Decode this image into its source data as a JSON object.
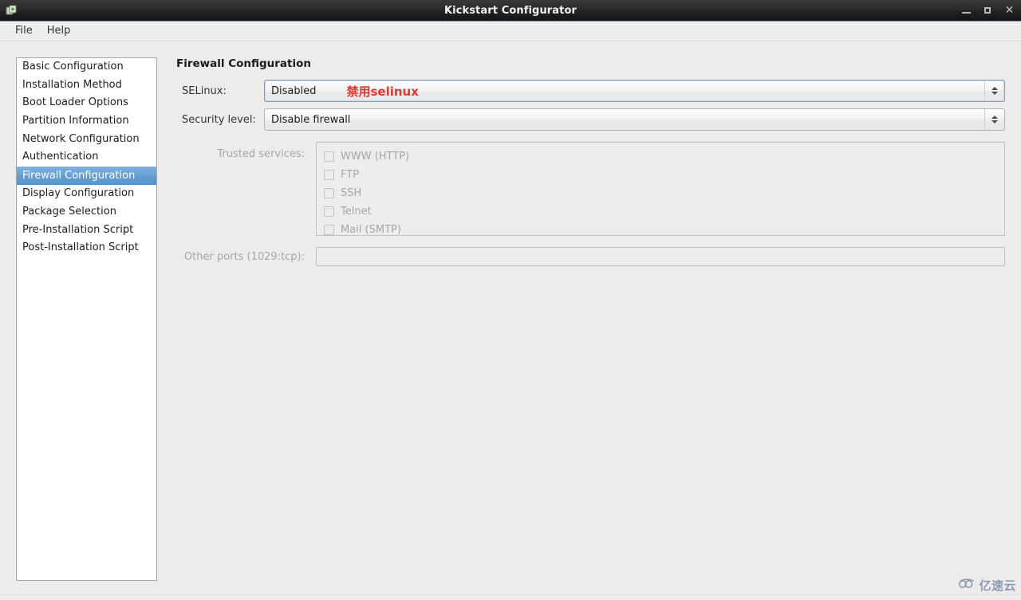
{
  "window": {
    "title": "Kickstart Configurator",
    "icon": "app-icon",
    "controls": {
      "minimize": "minimize-button",
      "maximize": "maximize-button",
      "close": "✕"
    }
  },
  "menubar": {
    "items": [
      {
        "label": "File"
      },
      {
        "label": "Help"
      }
    ]
  },
  "sidebar": {
    "items": [
      {
        "label": "Basic Configuration",
        "selected": false
      },
      {
        "label": "Installation Method",
        "selected": false
      },
      {
        "label": "Boot Loader Options",
        "selected": false
      },
      {
        "label": "Partition Information",
        "selected": false
      },
      {
        "label": "Network Configuration",
        "selected": false
      },
      {
        "label": "Authentication",
        "selected": false
      },
      {
        "label": "Firewall Configuration",
        "selected": true
      },
      {
        "label": "Display Configuration",
        "selected": false
      },
      {
        "label": "Package Selection",
        "selected": false
      },
      {
        "label": "Pre-Installation Script",
        "selected": false
      },
      {
        "label": "Post-Installation Script",
        "selected": false
      }
    ],
    "selected_index": 6,
    "selected_bg": "#6aa3d6",
    "selected_fg": "#ffffff"
  },
  "main": {
    "panel_title": "Firewall Configuration",
    "selinux": {
      "label": "SELinux:",
      "value": "Disabled",
      "annotation": "禁用selinux",
      "annotation_color": "#e3382f",
      "focused": true
    },
    "security_level": {
      "label": "Security level:",
      "value": "Disable firewall",
      "focused": false
    },
    "trusted_services": {
      "label": "Trusted services:",
      "disabled": true,
      "items": [
        {
          "label": "WWW (HTTP)",
          "checked": false
        },
        {
          "label": "FTP",
          "checked": false
        },
        {
          "label": "SSH",
          "checked": false
        },
        {
          "label": "Telnet",
          "checked": false
        },
        {
          "label": "Mail (SMTP)",
          "checked": false
        }
      ]
    },
    "other_ports": {
      "label": "Other ports (1029:tcp):",
      "value": "",
      "placeholder": "",
      "disabled": true
    }
  },
  "watermark": {
    "text": "亿速云",
    "color": "#8a9bb4"
  }
}
